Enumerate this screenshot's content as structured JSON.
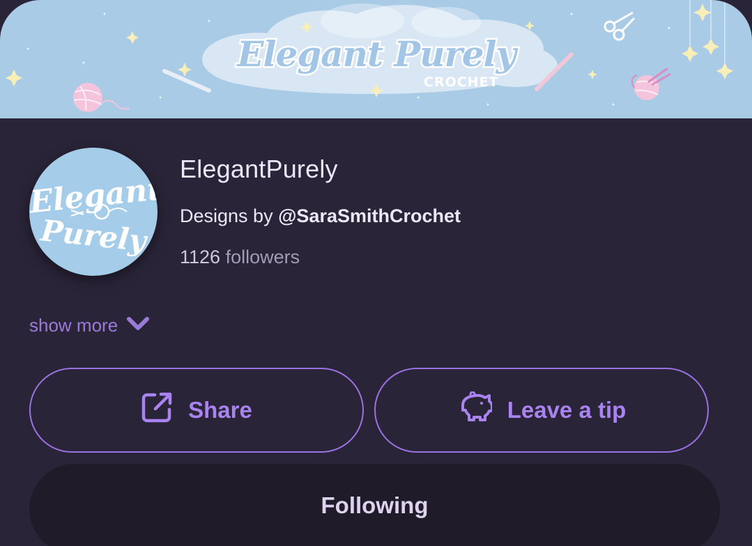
{
  "banner": {
    "title": "Elegant Purely",
    "subtitle": "CROCHET"
  },
  "profile": {
    "name": "ElegantPurely",
    "designs_prefix": "Designs by",
    "designs_handle": "@SaraSmithCrochet",
    "followers_count": "1126",
    "followers_label": "followers",
    "avatar_text_line1": "Elegant",
    "avatar_text_line2": "Purely"
  },
  "show_more_label": "show more",
  "actions": {
    "share_label": "Share",
    "tip_label": "Leave a tip",
    "follow_label": "Following"
  },
  "colors": {
    "background": "#2a2438",
    "banner": "#a9cbe6",
    "accent": "#9b72e4",
    "follow_button_bg": "#1f1b29"
  }
}
